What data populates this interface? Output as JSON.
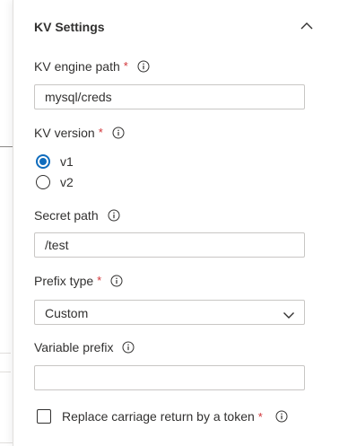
{
  "section": {
    "title": "KV Settings",
    "collapse_icon": "chevron-up-icon"
  },
  "kv_engine_path": {
    "label": "KV engine path",
    "required_mark": "*",
    "value": "mysql/creds",
    "info_icon": "info-icon"
  },
  "kv_version": {
    "label": "KV version",
    "required_mark": "*",
    "info_icon": "info-icon",
    "options": [
      {
        "label": "v1",
        "selected": true
      },
      {
        "label": "v2",
        "selected": false
      }
    ]
  },
  "secret_path": {
    "label": "Secret path",
    "value": "/test",
    "info_icon": "info-icon"
  },
  "prefix_type": {
    "label": "Prefix type",
    "required_mark": "*",
    "selected": "Custom",
    "info_icon": "info-icon",
    "dropdown_icon": "chevron-down-icon"
  },
  "variable_prefix": {
    "label": "Variable prefix",
    "value": "",
    "info_icon": "info-icon"
  },
  "replace_carriage_return": {
    "label": "Replace carriage return by a token",
    "required_mark": "*",
    "checked": false,
    "info_icon": "info-icon"
  },
  "colors": {
    "required": "#d13438",
    "accent": "#0f6cbd",
    "border": "#c8c6c4",
    "text": "#323130"
  }
}
